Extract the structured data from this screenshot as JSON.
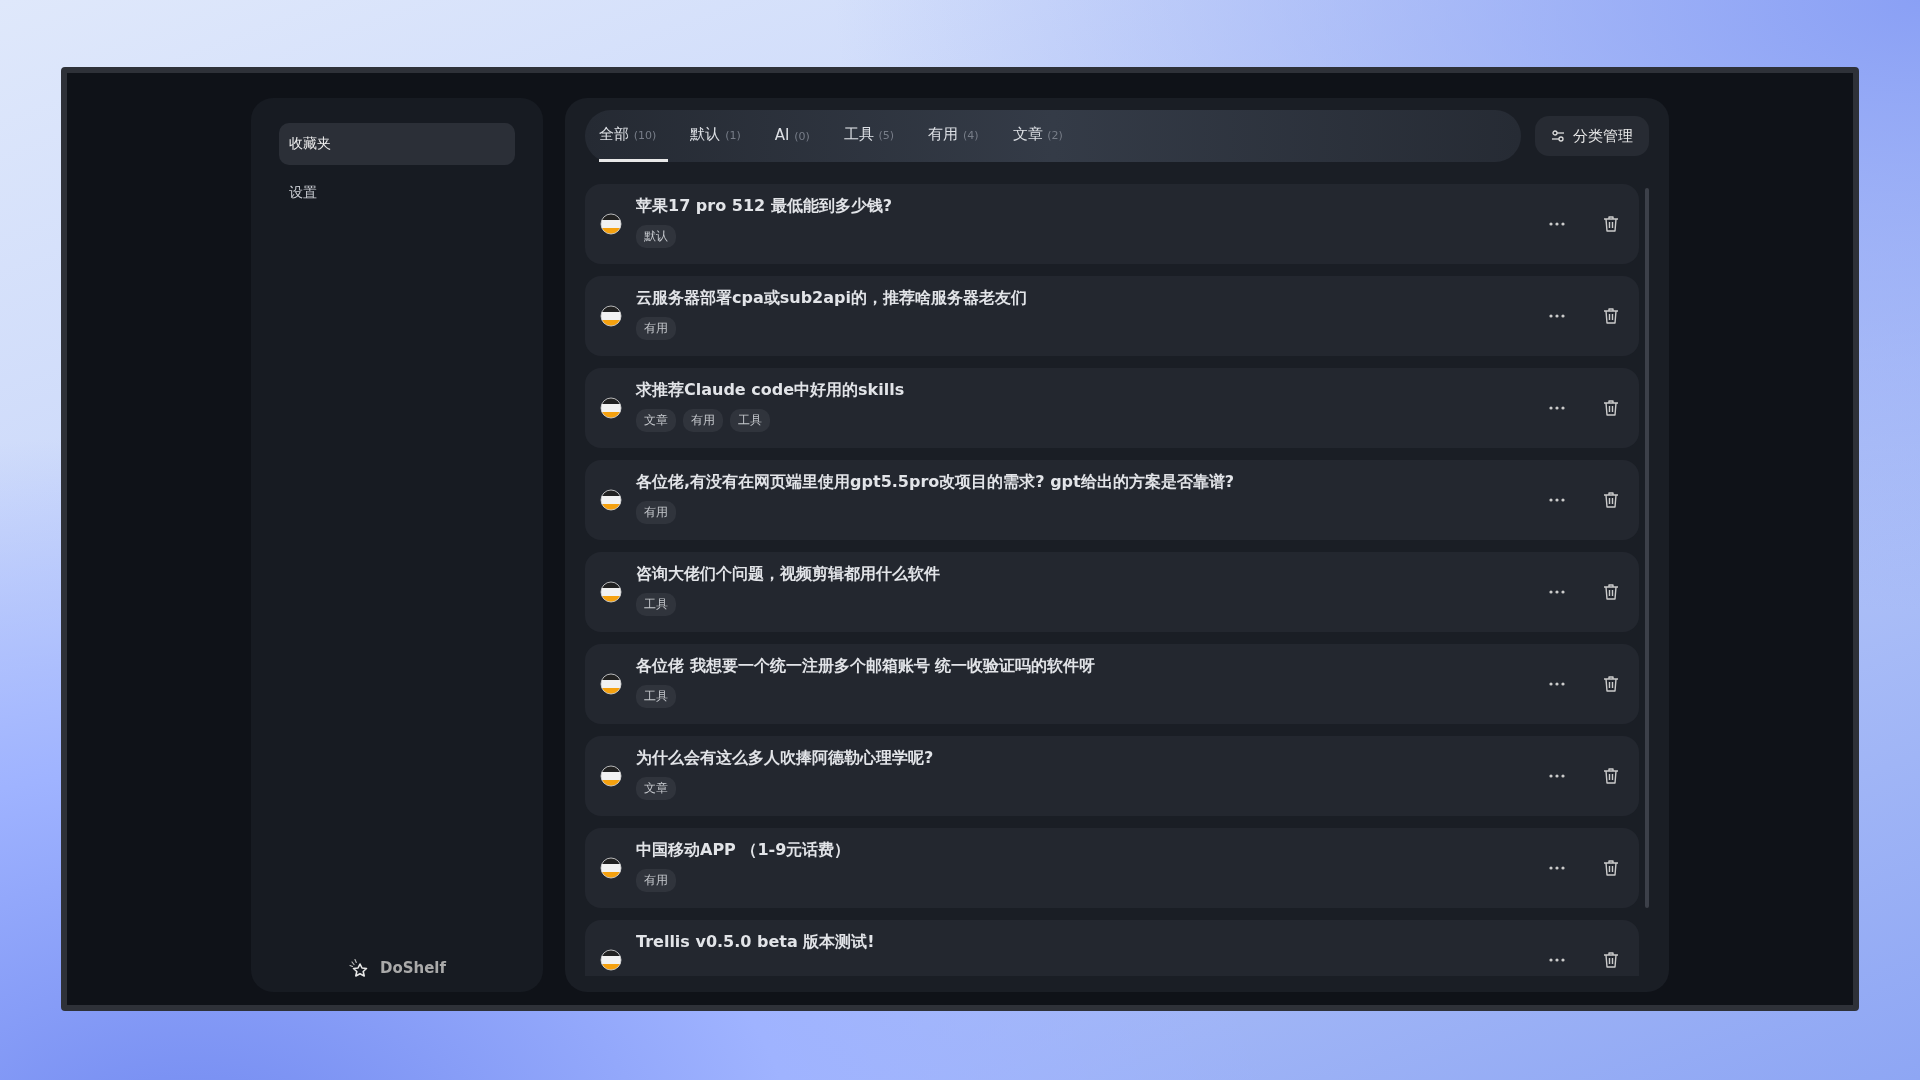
{
  "sidebar": {
    "items": [
      {
        "label": "收藏夹",
        "selected": true
      },
      {
        "label": "设置",
        "selected": false
      }
    ],
    "brand": "DoShelf"
  },
  "tabs": [
    {
      "label": "全部",
      "count": "(10)",
      "selected": true
    },
    {
      "label": "默认",
      "count": "(1)",
      "selected": false
    },
    {
      "label": "AI",
      "count": "(0)",
      "selected": false
    },
    {
      "label": "工具",
      "count": "(5)",
      "selected": false
    },
    {
      "label": "有用",
      "count": "(4)",
      "selected": false
    },
    {
      "label": "文章",
      "count": "(2)",
      "selected": false
    }
  ],
  "manage_button": "分类管理",
  "bookmarks": [
    {
      "title": "苹果17 pro 512 最低能到多少钱?",
      "tags": [
        "默认"
      ]
    },
    {
      "title": "云服务器部署cpa或sub2api的，推荐啥服务器老友们",
      "tags": [
        "有用"
      ]
    },
    {
      "title": "求推荐Claude code中好用的skills",
      "tags": [
        "文章",
        "有用",
        "工具"
      ]
    },
    {
      "title": "各位佬,有没有在网页端里使用gpt5.5pro改项目的需求? gpt给出的方案是否靠谱?",
      "tags": [
        "有用"
      ]
    },
    {
      "title": "咨询大佬们个问题，视频剪辑都用什么软件",
      "tags": [
        "工具"
      ]
    },
    {
      "title": "各位佬 我想要一个统一注册多个邮箱账号 统一收验证吗的软件呀",
      "tags": [
        "工具"
      ]
    },
    {
      "title": "为什么会有这么多人吹捧阿德勒心理学呢?",
      "tags": [
        "文章"
      ]
    },
    {
      "title": "中国移动APP （1-9元话费）",
      "tags": [
        "有用"
      ]
    },
    {
      "title": "Trellis v0.5.0 beta 版本测试!"
    }
  ]
}
